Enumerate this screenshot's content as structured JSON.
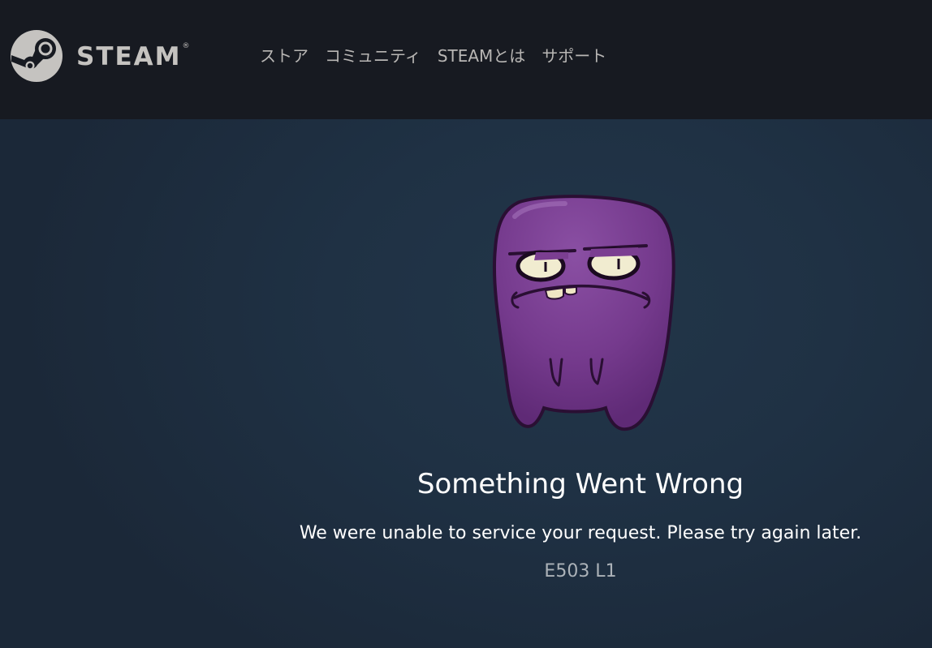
{
  "header": {
    "brand": "STEAM",
    "brand_mark": "®",
    "logo_icon": "steam-logo-icon",
    "nav": [
      {
        "label": "ストア"
      },
      {
        "label": "コミュニティ"
      },
      {
        "label": "STEAMとは"
      },
      {
        "label": "サポート"
      }
    ]
  },
  "error": {
    "title": "Something Went Wrong",
    "message": "We were unable to service your request. Please try again later.",
    "code": "E503 L1",
    "illustration": "purple-monster-illustration"
  },
  "colors": {
    "header_bg": "#171a21",
    "page_bg": "#1b2838",
    "nav_text": "#b8b6b4",
    "code_text": "#acb2b8",
    "monster": "#7b3e91"
  }
}
